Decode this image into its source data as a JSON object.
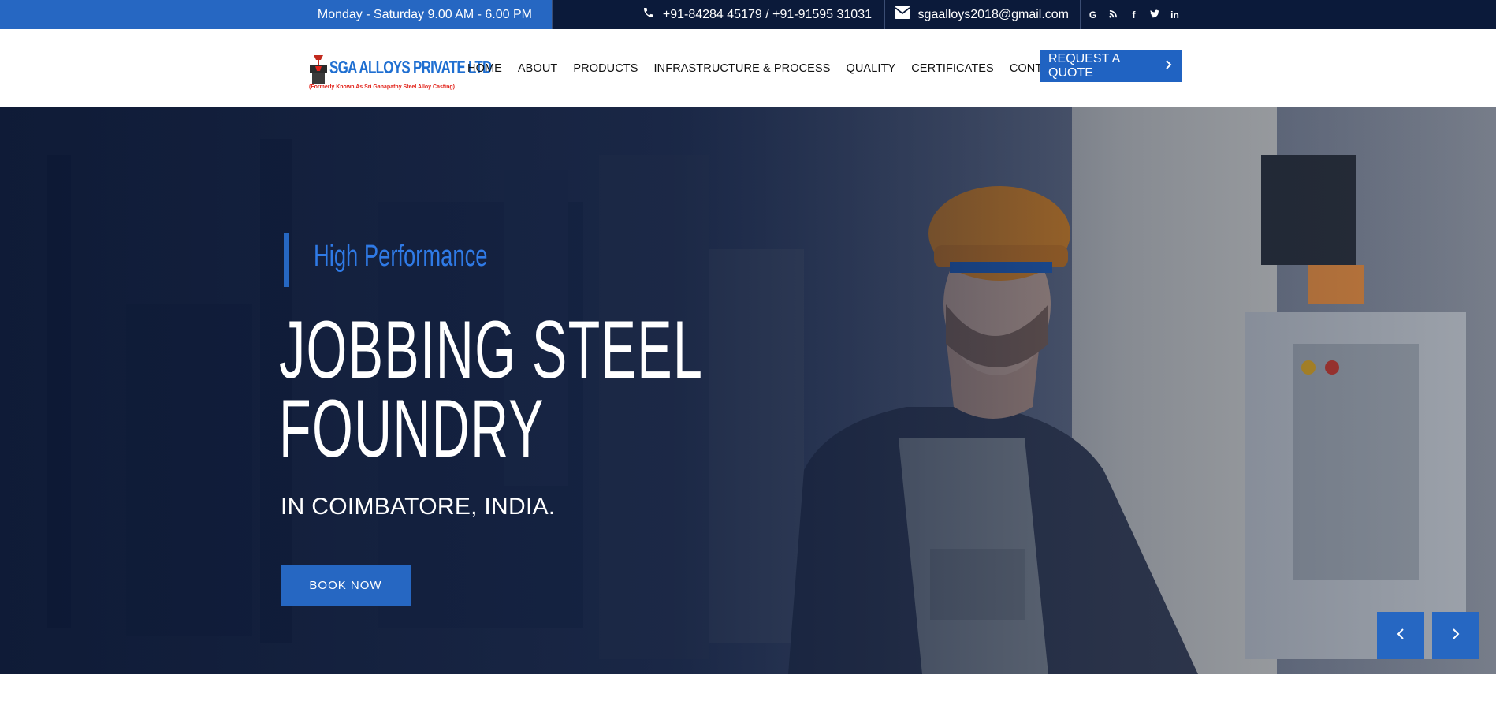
{
  "topbar": {
    "hours": "Monday - Saturday  9.00 AM - 6.00 PM",
    "phone": "+91-84284 45179 / +91-91595 31031",
    "email": "sgaalloys2018@gmail.com",
    "social": [
      "G",
      "rss",
      "f",
      "t",
      "in"
    ]
  },
  "header": {
    "logo_name": "SGA ALLOYS PRIVATE LTD",
    "logo_sub": "(Formerly Known As Sri Ganapathy Steel Alloy Casting)",
    "nav": [
      "HOME",
      "ABOUT",
      "PRODUCTS",
      "INFRASTRUCTURE & PROCESS",
      "QUALITY",
      "CERTIFICATES",
      "CONTACT US"
    ],
    "quote_label": "REQUEST A QUOTE"
  },
  "hero": {
    "kicker": "High Performance",
    "headline_line1": "JOBBING STEEL",
    "headline_line2": "FOUNDRY",
    "subline": "IN COIMBATORE, INDIA.",
    "cta_label": "BOOK NOW"
  },
  "colors": {
    "accent": "#2667c2",
    "topbar_bg": "#0b1a3a",
    "logo_blue": "#1f6fd1",
    "logo_red": "#e2231a"
  },
  "icons": {
    "phone": "phone-icon",
    "mail": "mail-icon",
    "quote_arrow": "chevron-right-icon",
    "prev": "chevron-left-icon",
    "next": "chevron-right-icon"
  }
}
